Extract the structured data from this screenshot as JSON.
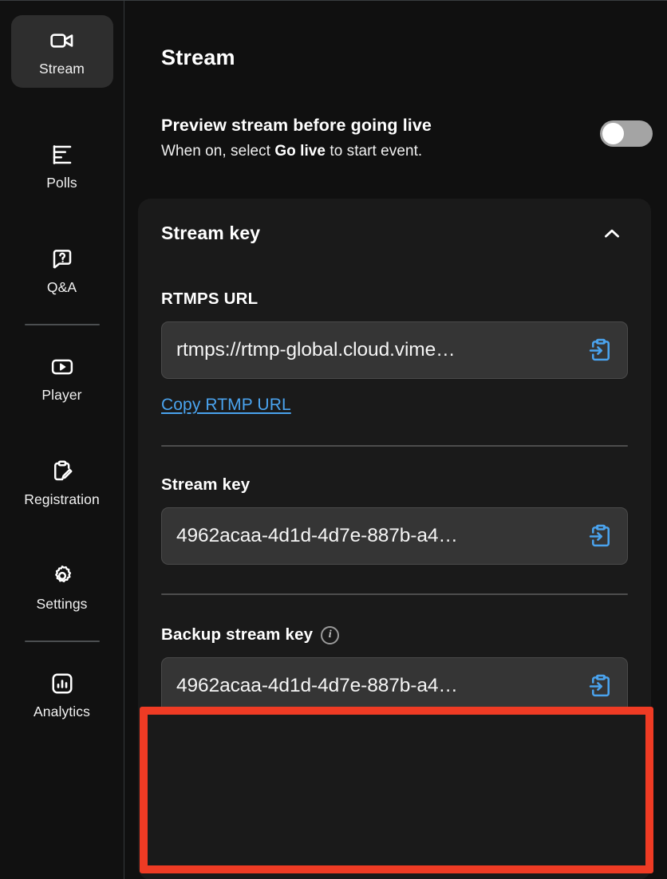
{
  "sidebar": {
    "items": [
      {
        "label": "Stream",
        "icon": "video-camera-icon",
        "active": true
      },
      {
        "label": "Polls",
        "icon": "poll-bars-icon",
        "active": false
      },
      {
        "label": "Q&A",
        "icon": "question-bubble-icon",
        "active": false
      },
      {
        "label": "Player",
        "icon": "play-box-icon",
        "active": false
      },
      {
        "label": "Registration",
        "icon": "clipboard-pencil-icon",
        "active": false
      },
      {
        "label": "Settings",
        "icon": "gear-icon",
        "active": false
      },
      {
        "label": "Analytics",
        "icon": "bar-chart-box-icon",
        "active": false
      }
    ]
  },
  "main": {
    "page_title": "Stream",
    "preview": {
      "title": "Preview stream before going live",
      "subtitle_before": "When on, select ",
      "subtitle_bold": "Go live",
      "subtitle_after": " to start event.",
      "toggle_state": "off"
    },
    "card": {
      "title": "Stream key",
      "collapse_icon": "chevron-up-icon",
      "rtmps": {
        "label": "RTMPS URL",
        "value": "rtmps://rtmp-global.cloud.vime…",
        "copy_icon": "copy-to-clipboard-icon",
        "copy_link": "Copy RTMP URL"
      },
      "stream_key": {
        "label": "Stream key",
        "value": "4962acaa-4d1d-4d7e-887b-a4…",
        "copy_icon": "copy-to-clipboard-icon"
      },
      "backup_key": {
        "label": "Backup stream key",
        "info_icon": "info-circle-icon",
        "value": "4962acaa-4d1d-4d7e-887b-a4…",
        "copy_icon": "copy-to-clipboard-icon"
      }
    }
  },
  "annotation": {
    "highlight_color": "#ef3b24",
    "target": "backup-stream-key-section"
  },
  "colors": {
    "background": "#101010",
    "sidebar": "#111111",
    "card": "#1a1a1a",
    "input": "#353535",
    "accent_link": "#4aa3ee",
    "active_nav": "#2e2e2e"
  }
}
